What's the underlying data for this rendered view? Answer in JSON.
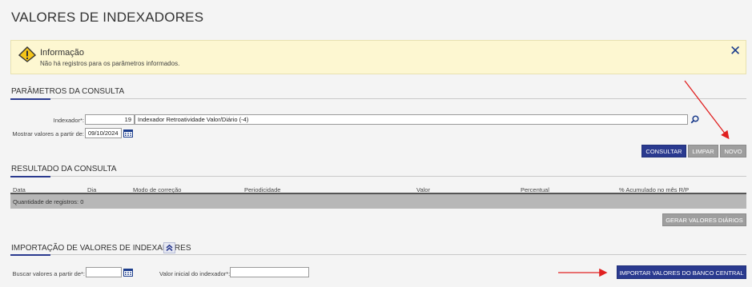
{
  "page": {
    "title": "VALORES DE INDEXADORES"
  },
  "alert": {
    "title": "Informação",
    "message": "Não há registros para os parâmetros informados.",
    "icon": "warning-icon",
    "close_icon": "close-icon"
  },
  "params": {
    "section_title": "PARÂMETROS DA CONSULTA",
    "indexador_label": "Indexador*:",
    "indexador_code": "19",
    "indexador_desc": "Indexador Retroatividade Valor/Diário (-4)",
    "mostrar_label": "Mostrar valores a partir de:",
    "mostrar_value": "09/10/2024",
    "buttons": {
      "consultar": "CONSULTAR",
      "limpar": "LIMPAR",
      "novo": "NOVO"
    }
  },
  "result": {
    "section_title": "RESULTADO DA CONSULTA",
    "columns": [
      "Data",
      "Dia",
      "Modo de correção",
      "Periodicidade",
      "Valor",
      "Percentual",
      "% Acumulado no mês R/P"
    ],
    "footer": "Quantidade de registros: 0",
    "gerar_button": "GERAR VALORES DIÁRIOS"
  },
  "import": {
    "section_title": "IMPORTAÇÃO DE VALORES DE INDEXADORES",
    "buscar_label": "Buscar valores a partir de*:",
    "buscar_value": "",
    "valor_label": "Valor inicial do indexador*:",
    "valor_value": "",
    "import_button": "IMPORTAR VALORES DO BANCO CENTRAL"
  },
  "colors": {
    "primary": "#2a3a8f",
    "gray_button": "#9e9e9e",
    "alert_bg": "#fdf7d1",
    "annotation_arrow": "#e02020"
  }
}
